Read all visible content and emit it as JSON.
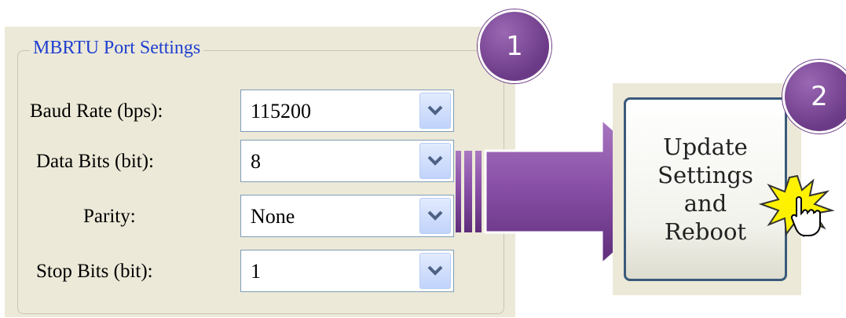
{
  "group": {
    "title": "MBRTU Port Settings"
  },
  "fields": [
    {
      "label": "Baud Rate (bps):",
      "value": "115200"
    },
    {
      "label": "Data Bits (bit):",
      "value": "8"
    },
    {
      "label": "Parity:",
      "value": "None"
    },
    {
      "label": "Stop Bits (bit):",
      "value": "1"
    }
  ],
  "badges": {
    "step1": "1",
    "step2": "2"
  },
  "update_button": {
    "label": "Update\nSettings\nand\nReboot"
  },
  "icons": {
    "dropdown": "chevron-down-icon",
    "arrow": "right-arrow-icon",
    "click": "click-burst-icon",
    "cursor": "hand-pointer-icon"
  },
  "colors": {
    "badge": "#7b4a96",
    "arrow": "#7a4396",
    "group_title": "#1f3fd0"
  }
}
